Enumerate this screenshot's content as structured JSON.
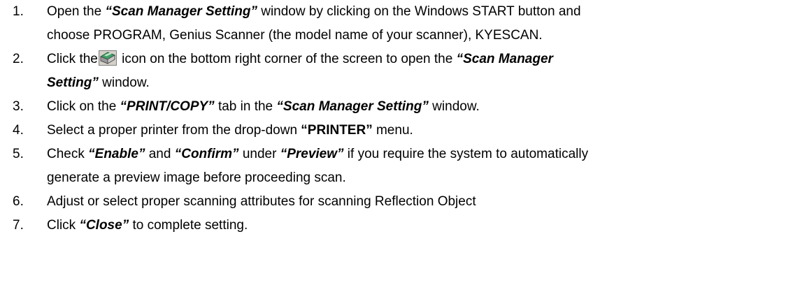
{
  "steps": [
    {
      "number": "1.",
      "line1_pre": "Open the ",
      "line1_em": "“Scan Manager Setting”",
      "line1_post": " window by clicking on the Windows START button and",
      "line2": "choose PROGRAM, Genius Scanner (the model name of your scanner), KYESCAN."
    },
    {
      "number": "2.",
      "line1_pre": "Click the",
      "icon": "scanner-tray-icon",
      "line1_mid": " icon on the bottom right corner of the screen to open the ",
      "line1_em": "“Scan Manager",
      "line2_em": "Setting”",
      "line2_post": " window."
    },
    {
      "number": "3.",
      "pre": "Click on the ",
      "em1": "“PRINT/COPY”",
      "mid": " tab in the ",
      "em2": "“Scan Manager Setting”",
      "post": " window."
    },
    {
      "number": "4.",
      "pre": "Select a proper printer from the drop-down ",
      "strong": "“PRINTER”",
      "post": " menu."
    },
    {
      "number": "5.",
      "pre": "Check ",
      "em1": "“Enable”",
      "mid1": " and ",
      "em2": "“Confirm”",
      "mid2": " under ",
      "em3": "“Preview”",
      "post": " if you require the system to automatically",
      "line2": "generate a preview image before proceeding scan."
    },
    {
      "number": "6.",
      "text": "Adjust or select proper scanning attributes for scanning Reflection Object"
    },
    {
      "number": "7.",
      "pre": "Click ",
      "em": "“Close”",
      "post": " to complete setting."
    }
  ]
}
